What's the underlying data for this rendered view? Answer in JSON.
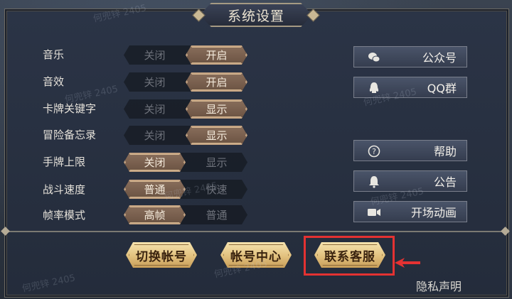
{
  "title": "系统设置",
  "settings": [
    {
      "label": "音乐",
      "left": "关闭",
      "right": "开启",
      "selected": "right"
    },
    {
      "label": "音效",
      "left": "关闭",
      "right": "开启",
      "selected": "right"
    },
    {
      "label": "卡牌关键字",
      "left": "关闭",
      "right": "显示",
      "selected": "right"
    },
    {
      "label": "冒险备忘录",
      "left": "关闭",
      "right": "显示",
      "selected": "right"
    },
    {
      "label": "手牌上限",
      "left": "关闭",
      "right": "显示",
      "selected": "left"
    },
    {
      "label": "战斗速度",
      "left": "普通",
      "right": "快速",
      "selected": "left"
    },
    {
      "label": "帧率模式",
      "left": "高帧",
      "right": "普通",
      "selected": "left"
    }
  ],
  "side_buttons": [
    {
      "label": "公众号",
      "icon": "wechat-icon"
    },
    {
      "label": "QQ群",
      "icon": "qq-icon"
    },
    {
      "label": "帮助",
      "icon": "help-icon"
    },
    {
      "label": "公告",
      "icon": "bell-icon"
    },
    {
      "label": "开场动画",
      "icon": "video-icon"
    }
  ],
  "bottom_buttons": [
    "切换帐号",
    "帐号中心",
    "联系客服"
  ],
  "privacy": "隐私声明",
  "watermark": "何兜锌 2405",
  "colors": {
    "highlight": "#e43232",
    "accent_gold": "#e2c17e",
    "selected_toggle": "#7a5f4d"
  }
}
